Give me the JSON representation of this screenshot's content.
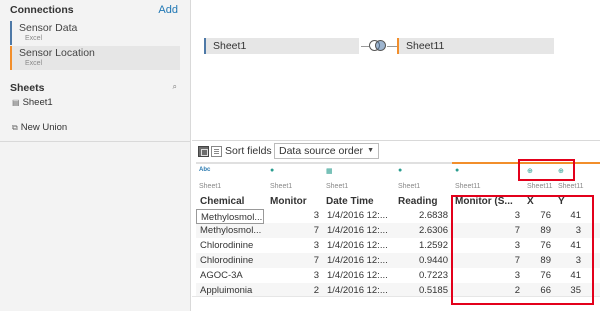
{
  "sidebar": {
    "connections_title": "Connections",
    "add_label": "Add",
    "connections": [
      {
        "name": "Sensor Data",
        "type": "Excel"
      },
      {
        "name": "Sensor Location",
        "type": "Excel"
      }
    ],
    "sheets_title": "Sheets",
    "sheet_item": "Sheet1",
    "new_union": "New Union"
  },
  "canvas": {
    "left_table": "Sheet1",
    "right_table": "Sheet11"
  },
  "toolbar": {
    "sort_label": "Sort fields",
    "sort_value": "Data source order"
  },
  "grid": {
    "columns": [
      {
        "type_icon": "Abc",
        "source": "Sheet1",
        "name": "Chemical"
      },
      {
        "type_icon": "#",
        "source": "Sheet1",
        "name": "Monitor"
      },
      {
        "type_icon": "calendar",
        "source": "Sheet1",
        "name": "Date Time"
      },
      {
        "type_icon": "#",
        "source": "Sheet1",
        "name": "Reading"
      },
      {
        "type_icon": "#",
        "source": "Sheet11",
        "name": "Monitor (S..."
      },
      {
        "type_icon": "globe",
        "source": "Sheet11",
        "name": "X"
      },
      {
        "type_icon": "globe",
        "source": "Sheet11",
        "name": "Y"
      }
    ],
    "rows": [
      [
        "Methylosmol...",
        "3",
        "1/4/2016 12:...",
        "2.6838",
        "3",
        "76",
        "41"
      ],
      [
        "Methylosmol...",
        "7",
        "1/4/2016 12:...",
        "2.6306",
        "7",
        "89",
        "3"
      ],
      [
        "Chlorodinine",
        "3",
        "1/4/2016 12:...",
        "1.2592",
        "3",
        "76",
        "41"
      ],
      [
        "Chlorodinine",
        "7",
        "1/4/2016 12:...",
        "0.9440",
        "7",
        "89",
        "3"
      ],
      [
        "AGOC-3A",
        "3",
        "1/4/2016 12:...",
        "0.7223",
        "3",
        "76",
        "41"
      ],
      [
        "Appluimonia",
        "2",
        "1/4/2016 12:...",
        "0.5185",
        "2",
        "66",
        "35"
      ]
    ]
  },
  "colors": {
    "sheet1_accent": "#4e79a7",
    "sheet11_accent": "#f28e2b",
    "highlight": "#e3001b",
    "link": "#1f77b4"
  }
}
